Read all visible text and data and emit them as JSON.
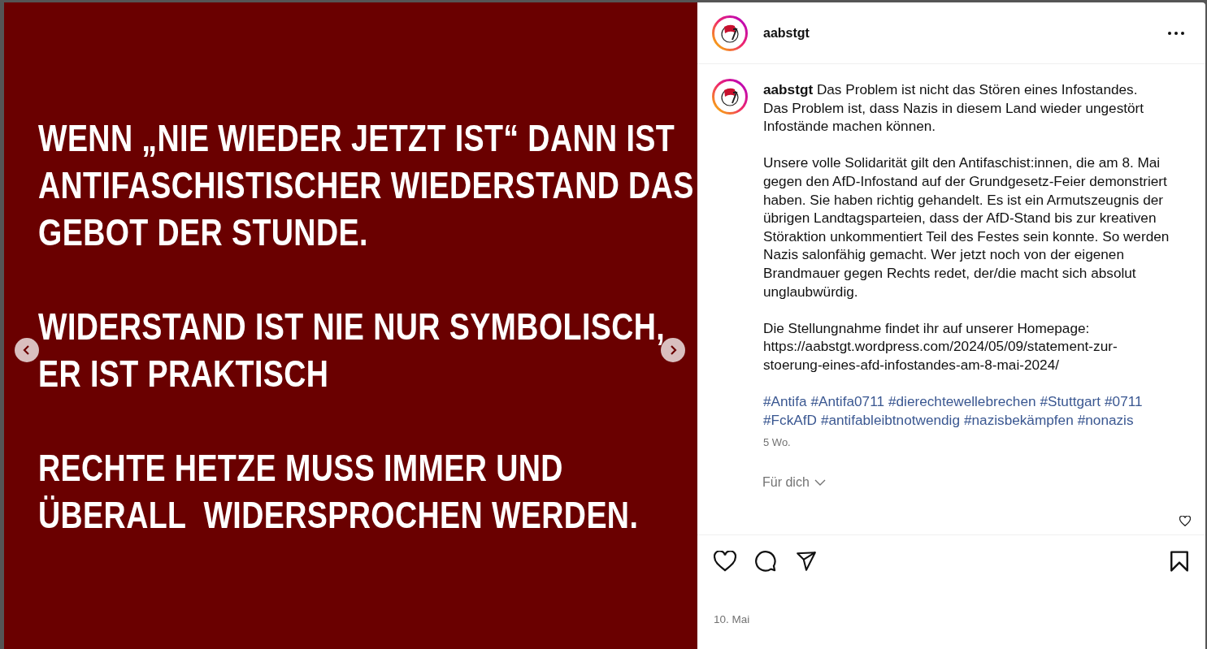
{
  "post_image": {
    "paragraphs": [
      "WENN „NIE WIEDER JETZT IST“ DANN IST\nANTIFASCHISTISCHER WIEDERSTAND DAS\nGEBOT DER STUNDE.",
      "WIDERSTAND IST NIE NUR SYMBOLISCH,\nER IST PRAKTISCH",
      "RECHTE HETZE MUSS IMMER UND\nÜBERALL  WIDERSPROCHEN WERDEN."
    ]
  },
  "author": {
    "username": "aabstgt"
  },
  "caption": {
    "paragraphs": [
      "**aabstgt** Das Problem ist nicht das Stören eines Infostandes.\nDas Problem ist, dass Nazis in diesem Land wieder ungestört Infostände machen können.",
      "Unsere volle Solidarität gilt den Antifaschist:innen, die am 8. Mai gegen den AfD-Infostand auf der Grundgesetz-Feier demonstriert haben. Sie haben richtig gehandelt. Es ist ein Armutszeugnis der übrigen Landtagsparteien, dass der AfD-Stand bis zur kreativen Störaktion unkommentiert Teil des Festes sein konnte. So werden Nazis salonfähig gemacht. Wer jetzt noch von der eigenen Brandmauer gegen Rechts redet, der/die macht sich absolut unglaubwürdig.",
      "Die Stellungnahme findet ihr auf unserer Homepage:\nhttps://aabstgt.wordpress.com/2024/05/09/statement-zur-stoerung-eines-afd-infostandes-am-8-mai-2024/"
    ],
    "hashtags": [
      "#Antifa",
      "#Antifa0711",
      "#dierechtewellebrechen",
      "#Stuttgart",
      "#0711",
      "#FckAfD",
      "#antifableibtnotwendig",
      "#nazisbekämpfen",
      "#nonazis"
    ],
    "age": "5 Wo."
  },
  "comment_sort": "Für dich",
  "date": "10. Mai"
}
